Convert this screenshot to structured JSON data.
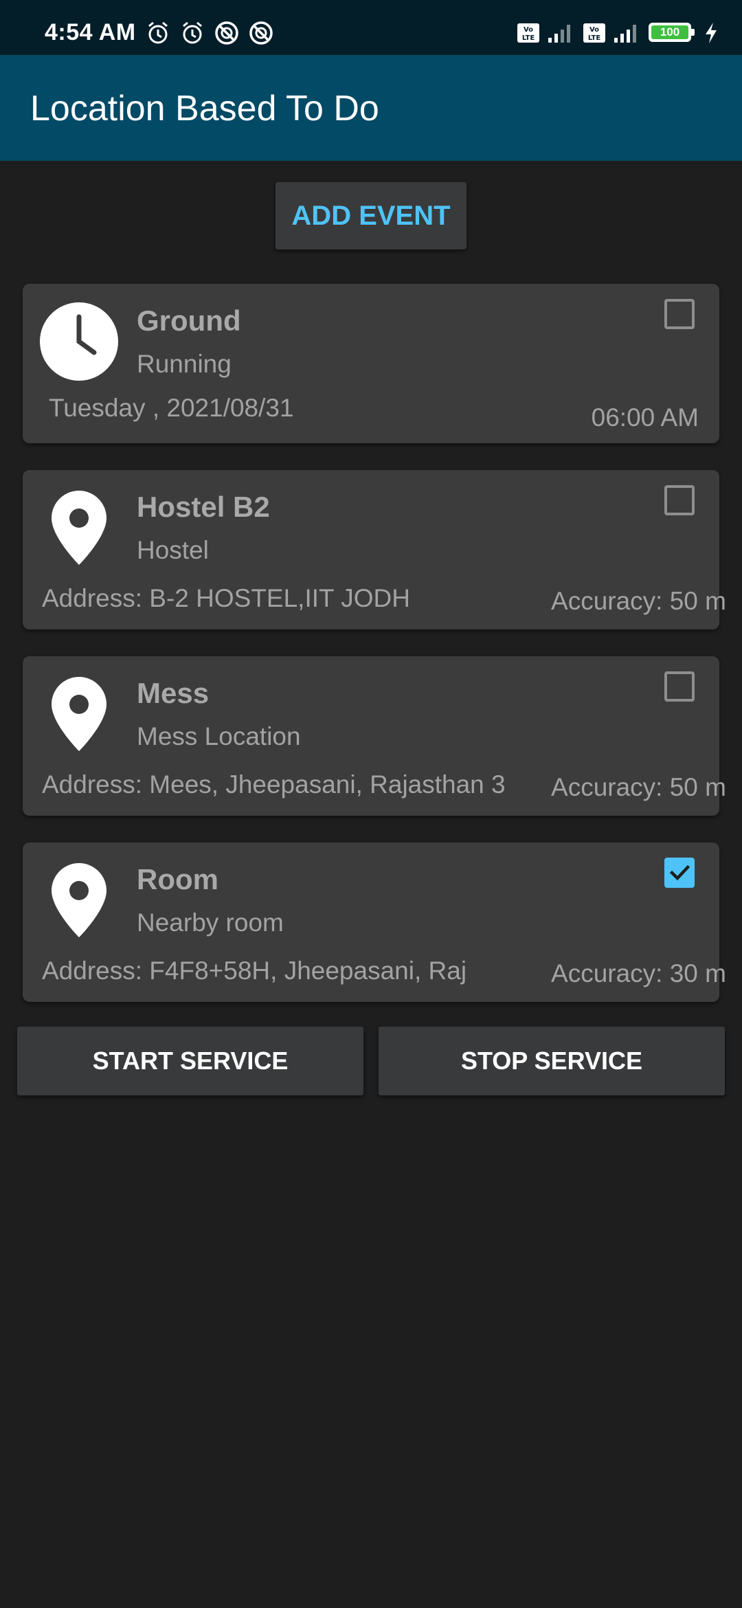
{
  "status_bar": {
    "time": "4:54 AM",
    "left_icons": [
      "alarm-icon",
      "alarm-icon",
      "blocked-notification-icon",
      "blocked-notification-icon"
    ],
    "right_icons": [
      "volte-icon",
      "signal-icon",
      "volte-icon",
      "signal-icon",
      "battery-icon",
      "charging-icon"
    ],
    "battery_level": "100"
  },
  "app_bar": {
    "title": "Location Based To Do"
  },
  "add_event_label": "ADD EVENT",
  "colors": {
    "accent": "#4fc3f7",
    "app_bar": "#024a66",
    "status_bar": "#041e29",
    "background": "#1e1e1e",
    "card": "#3c3c3c"
  },
  "events": [
    {
      "icon": "clock-icon",
      "title": "Ground",
      "subtitle": "Running",
      "left": "Tuesday , 2021/08/31",
      "right": "06:00 AM",
      "checked": false
    },
    {
      "icon": "location-pin-icon",
      "title": "Hostel B2",
      "subtitle": "Hostel",
      "left": "Address: B-2 HOSTEL,IIT JODH",
      "right": "Accuracy: 50 m",
      "checked": false
    },
    {
      "icon": "location-pin-icon",
      "title": "Mess",
      "subtitle": "Mess Location",
      "left": "Address: Mees, Jheepasani, Rajasthan 3",
      "right": "Accuracy: 50 m",
      "checked": false
    },
    {
      "icon": "location-pin-icon",
      "title": "Room",
      "subtitle": "Nearby room",
      "left": "Address: F4F8+58H, Jheepasani, Raj",
      "right": "Accuracy: 30 m",
      "checked": true
    }
  ],
  "buttons": {
    "start": "START SERVICE",
    "stop": "STOP SERVICE"
  }
}
